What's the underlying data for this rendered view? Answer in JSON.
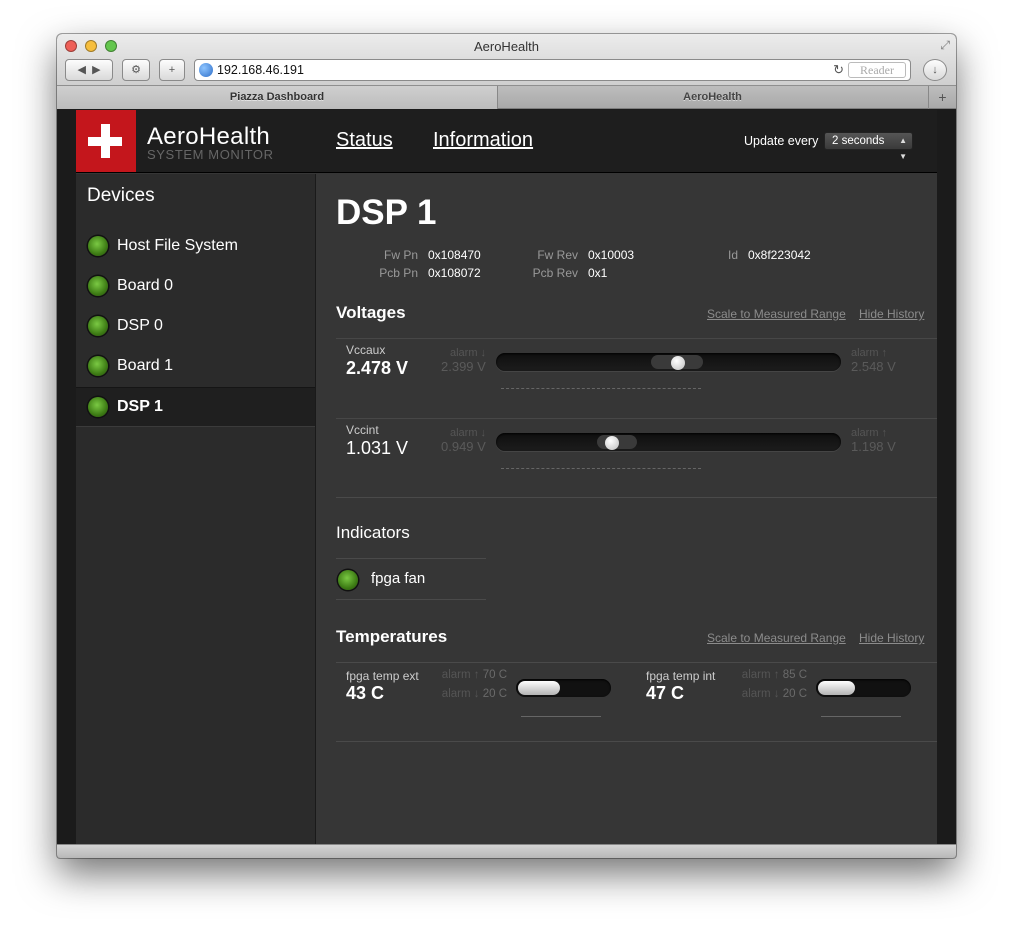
{
  "browser": {
    "window_title": "AeroHealth",
    "url": "192.168.46.191",
    "reader_label": "Reader",
    "tabs": [
      {
        "label": "Piazza Dashboard"
      },
      {
        "label": "AeroHealth"
      }
    ],
    "new_tab_label": "+"
  },
  "header": {
    "brand": "AeroHealth",
    "brand_sub": "SYSTEM MONITOR",
    "nav": [
      {
        "label": "Status"
      },
      {
        "label": "Information"
      }
    ],
    "update_label": "Update every",
    "update_value": "2 seconds"
  },
  "sidebar": {
    "title": "Devices",
    "devices": [
      {
        "label": "Host File System",
        "status": "ok"
      },
      {
        "label": "Board 0",
        "status": "ok"
      },
      {
        "label": "DSP 0",
        "status": "ok"
      },
      {
        "label": "Board 1",
        "status": "ok"
      },
      {
        "label": "DSP 1",
        "status": "ok",
        "selected": true
      }
    ]
  },
  "device": {
    "title": "DSP 1",
    "meta": [
      {
        "key": "Fw Pn",
        "value": "0x108470"
      },
      {
        "key": "Pcb Pn",
        "value": "0x108072"
      },
      {
        "key": "Fw Rev",
        "value": "0x10003"
      },
      {
        "key": "Pcb Rev",
        "value": "0x1"
      },
      {
        "key": "Id",
        "value": "0x8f223042"
      }
    ]
  },
  "voltages": {
    "title": "Voltages",
    "scale_link": "Scale to Measured Range",
    "hide_link": "Hide History",
    "items": [
      {
        "name": "Vccaux",
        "value": "2.478 V",
        "alarm_low_label": "alarm ↓",
        "alarm_low": "2.399 V",
        "alarm_high_label": "alarm ↑",
        "alarm_high": "2.548 V",
        "level": 0.53
      },
      {
        "name": "Vccint",
        "value": "1.031 V",
        "alarm_low_label": "alarm ↓",
        "alarm_low": "0.949 V",
        "alarm_high_label": "alarm ↑",
        "alarm_high": "1.198 V",
        "level": 0.33
      }
    ]
  },
  "indicators": {
    "title": "Indicators",
    "items": [
      {
        "label": "fpga fan",
        "status": "ok"
      }
    ]
  },
  "temperatures": {
    "title": "Temperatures",
    "scale_link": "Scale to Measured Range",
    "hide_link": "Hide History",
    "items": [
      {
        "name": "fpga temp ext",
        "value": "43 C",
        "alarm_high_label": "alarm ↑",
        "alarm_high": "70 C",
        "alarm_low_label": "alarm ↓",
        "alarm_low": "20 C",
        "level": 0.46
      },
      {
        "name": "fpga temp int",
        "value": "47 C",
        "alarm_high_label": "alarm ↑",
        "alarm_high": "85 C",
        "alarm_low_label": "alarm ↓",
        "alarm_low": "20 C",
        "level": 0.41
      }
    ]
  },
  "colors": {
    "accent": "#c4161c",
    "led_ok": "#5aa52a"
  }
}
